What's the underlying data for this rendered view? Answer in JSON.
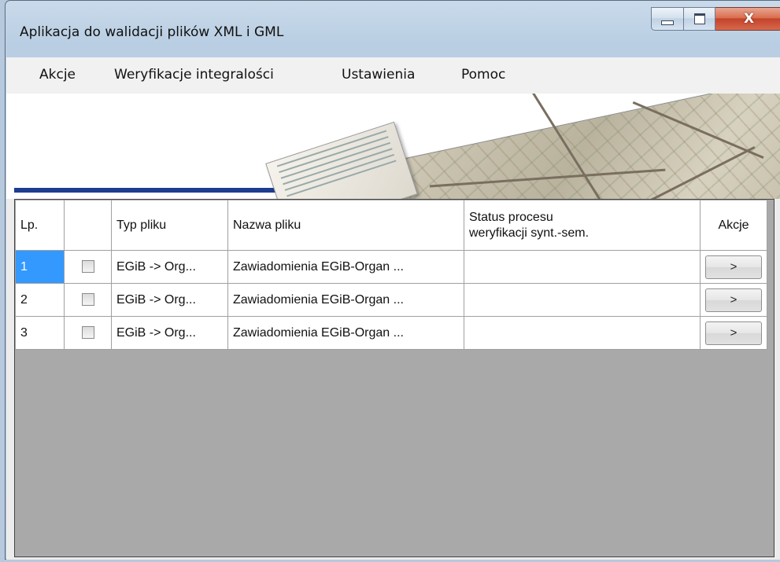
{
  "window": {
    "title": "Aplikacja do walidacji plików XML i GML",
    "close_glyph": "X"
  },
  "menu": {
    "items": [
      {
        "label": "Akcje"
      },
      {
        "label": "Weryfikacje integralości"
      },
      {
        "label": "Ustawienia"
      },
      {
        "label": "Pomoc"
      }
    ]
  },
  "grid": {
    "columns": {
      "lp": "Lp.",
      "check": "",
      "type": "Typ pliku",
      "name": "Nazwa pliku",
      "status_line1": "Status procesu",
      "status_line2": "weryfikacji synt.-sem.",
      "actions": "Akcje"
    },
    "rows": [
      {
        "lp": "1",
        "checked": false,
        "type": "EGiB -> Org...",
        "name": "Zawiadomienia EGiB-Organ ...",
        "status": "",
        "action_label": ">"
      },
      {
        "lp": "2",
        "checked": false,
        "type": "EGiB -> Org...",
        "name": "Zawiadomienia EGiB-Organ ...",
        "status": "",
        "action_label": ">"
      },
      {
        "lp": "3",
        "checked": false,
        "type": "EGiB -> Org...",
        "name": "Zawiadomienia EGiB-Organ ...",
        "status": "",
        "action_label": ">"
      }
    ],
    "selected_row": 0
  },
  "colors": {
    "selection": "#3399ff",
    "banner_stripe": "#1d3d8f",
    "grid_background": "#a9a9a9"
  }
}
